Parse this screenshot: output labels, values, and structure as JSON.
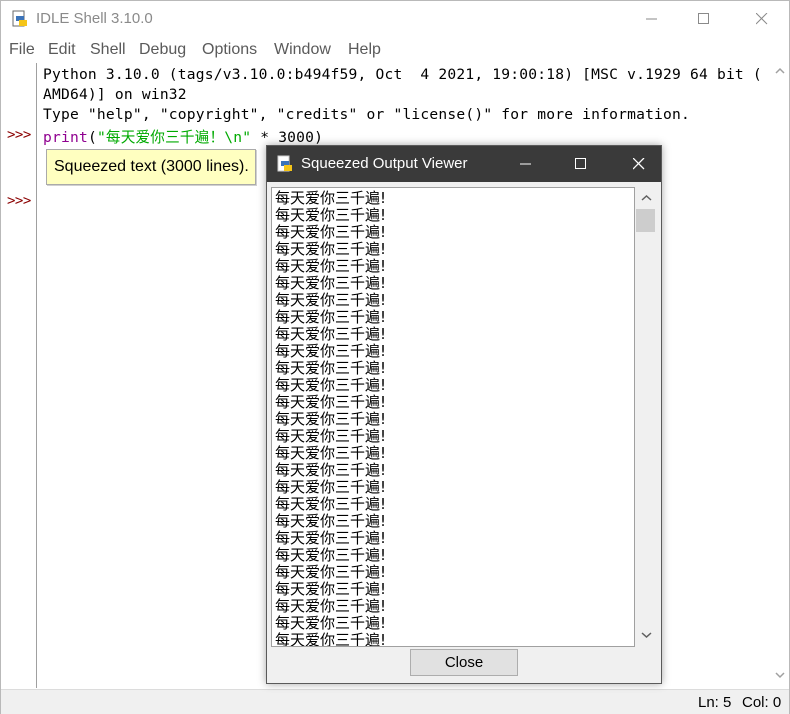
{
  "window": {
    "title": "IDLE Shell 3.10.0",
    "controls": {
      "minimize": "minimize-icon",
      "maximize": "maximize-icon",
      "close": "close-icon"
    }
  },
  "menu": [
    "File",
    "Edit",
    "Shell",
    "Debug",
    "Options",
    "Window",
    "Help"
  ],
  "shell": {
    "prompts": [
      ">>>",
      ">>>"
    ],
    "banner_line1": "Python 3.10.0 (tags/v3.10.0:b494f59, Oct  4 2021, 19:00:18) [MSC v.1929 64 bit (",
    "banner_line2": "AMD64)] on win32",
    "banner_line3": "Type \"help\", \"copyright\", \"credits\" or \"license()\" for more information.",
    "input_keyword": "print",
    "input_open": "(",
    "input_string": "\"每天爱你三千遍！\\n\"",
    "input_rest": " * 3000)",
    "squeezed_label": "Squeezed text (3000 lines)."
  },
  "status": {
    "ln": "Ln: 5",
    "col": "Col: 0"
  },
  "dialog": {
    "title": "Squeezed Output Viewer",
    "line_text": "每天爱你三千遍!",
    "visible_lines": 27,
    "close_label": "Close"
  },
  "colors": {
    "prompt": "#8b0000",
    "keyword": "#900090",
    "string": "#00aa00",
    "squeeze_bg": "#ffffc0",
    "dialog_titlebar": "#3a3a3a"
  }
}
